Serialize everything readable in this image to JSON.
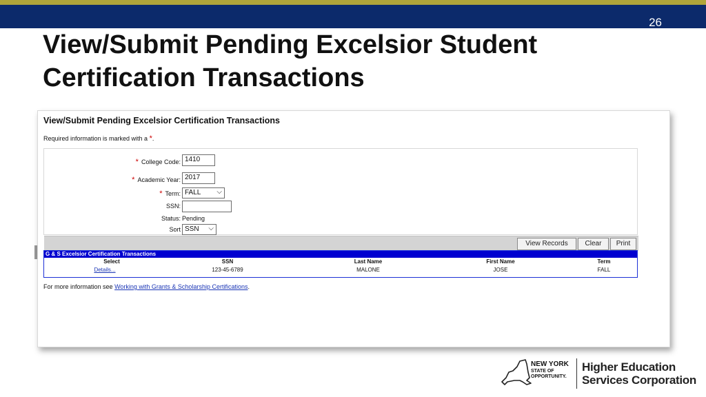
{
  "slide": {
    "number": "26",
    "title": "View/Submit Pending Excelsior Student Certification Transactions"
  },
  "app": {
    "title": "View/Submit Pending Excelsior Certification Transactions",
    "required_note": "Required information is marked with a",
    "required_mark": "*",
    "required_end": "."
  },
  "form": {
    "college_code": {
      "label": "College Code:",
      "value": "1410"
    },
    "academic_year": {
      "label": "Academic Year:",
      "value": "2017"
    },
    "term": {
      "label": "Term:",
      "value": "FALL"
    },
    "ssn": {
      "label": "SSN:",
      "value": ""
    },
    "status": {
      "label": "Status:",
      "value": "Pending"
    },
    "sort": {
      "label": "Sort",
      "value": "SSN"
    }
  },
  "buttons": {
    "view_records": "View Records",
    "clear": "Clear",
    "print": "Print"
  },
  "results": {
    "heading": "G & S Excelsior Certification Transactions",
    "columns": [
      "Select",
      "SSN",
      "Last Name",
      "First Name",
      "Term"
    ],
    "rows": [
      {
        "select": "Details...",
        "ssn": "123-45-6789",
        "last_name": "MALONE",
        "first_name": "JOSE",
        "term": "FALL"
      }
    ]
  },
  "more_info": {
    "prefix": "For more information see",
    "link": "Working with Grants & Scholarship Certifications",
    "suffix": "."
  },
  "logo": {
    "ny_line1": "NEW YORK",
    "ny_line2": "STATE OF",
    "ny_line3": "OPPORTUNITY.",
    "org_line1": "Higher Education",
    "org_line2": "Services Corporation"
  },
  "colors": {
    "gold": "#b0a53a",
    "navy": "#0c2a6b",
    "results_header": "#0000d0",
    "link": "#1a35b5",
    "required": "#cc0000"
  }
}
